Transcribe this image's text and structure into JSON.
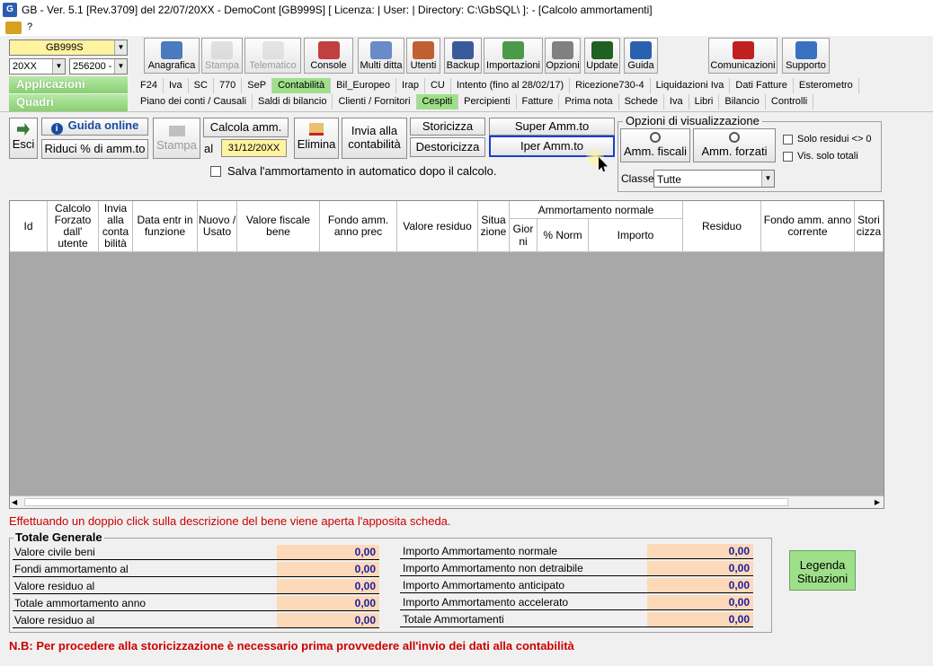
{
  "window": {
    "title": "GB - Ver. 5.1 [Rev.3709] del 22/07/20XX -  DemoCont [GB999S]   [ Licenza:                              | User:           | Directory: C:\\GbSQL\\ ]: - [Calcolo ammortamenti]",
    "menu_icon": "app-menu-icon",
    "menu_help": "?"
  },
  "selectors": {
    "company": "GB999S",
    "year": "20XX",
    "code": "256200 -",
    "applicazioni": "Applicazioni",
    "quadri": "Quadri"
  },
  "toolbar": [
    {
      "label": "Anagrafica",
      "icon": "address-book-icon",
      "enabled": true
    },
    {
      "label": "Stampa",
      "icon": "printer-icon",
      "enabled": false
    },
    {
      "label": "Telematico",
      "icon": "telematic-icon",
      "enabled": false
    },
    {
      "label": "Console",
      "icon": "console-icon",
      "enabled": true
    },
    {
      "label": "Multi ditta",
      "icon": "multi-company-icon",
      "enabled": true
    },
    {
      "label": "Utenti",
      "icon": "users-icon",
      "enabled": true
    },
    {
      "label": "Backup",
      "icon": "backup-icon",
      "enabled": true
    },
    {
      "label": "Importazioni",
      "icon": "import-icon",
      "enabled": true
    },
    {
      "label": "Opzioni",
      "icon": "tools-icon",
      "enabled": true
    },
    {
      "label": "Update",
      "icon": "update-icon",
      "enabled": true
    },
    {
      "label": "Guida",
      "icon": "help-icon",
      "enabled": true
    },
    {
      "label": "Comunicazioni",
      "icon": "communications-icon",
      "enabled": true
    },
    {
      "label": "Supporto",
      "icon": "support-icon",
      "enabled": true
    }
  ],
  "tabs_row1": [
    "F24",
    "Iva",
    "SC",
    "770",
    "SeP",
    "Contabilità",
    "Bil_Europeo",
    "Irap",
    "CU",
    "Intento (fino al 28/02/17)",
    "Ricezione730-4",
    "Liquidazioni Iva",
    "Dati Fatture",
    "Esterometro"
  ],
  "tabs_row2": [
    "Piano dei conti / Causali",
    "Saldi di bilancio",
    "Clienti / Fornitori",
    "Cespiti",
    "Percipienti",
    "Fatture",
    "Prima nota",
    "Schede",
    "Iva",
    "Libri",
    "Bilancio",
    "Controlli"
  ],
  "active_tab_row1": "Contabilità",
  "active_tab_row2": "Cespiti",
  "actions": {
    "esci": "Esci",
    "guida_online": "Guida online",
    "riduci": "Riduci % di amm.to",
    "stampa": "Stampa",
    "calcola": "Calcola amm.",
    "al": "al",
    "date": "31/12/20XX",
    "elimina": "Elimina",
    "invia_1": "Invia alla",
    "invia_2": "contabilità",
    "storicizza": "Storicizza",
    "destoricizza": "Destoricizza",
    "super": "Super Amm.to",
    "iper": "Iper Amm.to",
    "salva_auto": "Salva l'ammortamento in automatico dopo il calcolo."
  },
  "options": {
    "title": "Opzioni di visualizzazione",
    "amm_fiscali": "Amm. fiscali",
    "amm_forzati": "Amm. forzati",
    "solo_residui": "Solo residui <> 0",
    "vis_totali": "Vis. solo totali",
    "classe_label": "Classe",
    "classe_value": "Tutte"
  },
  "grid": {
    "columns": [
      {
        "key": "id",
        "label": "Id"
      },
      {
        "key": "calcolo",
        "label": "Calcolo Forzato dall' utente"
      },
      {
        "key": "invia",
        "label": "Invia alla conta bilità"
      },
      {
        "key": "data",
        "label": "Data entr in funzione"
      },
      {
        "key": "nuovo",
        "label": "Nuovo / Usato"
      },
      {
        "key": "valore_fiscale",
        "label": "Valore fiscale bene"
      },
      {
        "key": "fondo_prec",
        "label": "Fondo amm. anno prec"
      },
      {
        "key": "valore_residuo",
        "label": "Valore residuo"
      },
      {
        "key": "situazione",
        "label": "Situa zione"
      },
      {
        "key": "giorni",
        "label": "Gior ni"
      },
      {
        "key": "norm",
        "label": "% Norm"
      },
      {
        "key": "importo",
        "label": "Importo"
      },
      {
        "key": "residuo",
        "label": "Residuo"
      },
      {
        "key": "fondo_corrente",
        "label": "Fondo amm. anno corrente"
      },
      {
        "key": "storicizza",
        "label": "Stori cizza"
      }
    ],
    "group_header": "Ammortamento normale"
  },
  "hint": "Effettuando un doppio click sulla descrizione del bene viene aperta l'apposita scheda.",
  "totals": {
    "title": "Totale Generale",
    "left": [
      {
        "label": "Valore civile beni",
        "value": "0,00"
      },
      {
        "label": "Fondi ammortamento al",
        "value": "0,00"
      },
      {
        "label": "Valore residuo al",
        "value": "0,00"
      },
      {
        "label": "Totale ammortamento anno",
        "value": "0,00"
      },
      {
        "label": "Valore residuo al",
        "value": "0,00"
      }
    ],
    "right": [
      {
        "label": "Importo Ammortamento normale",
        "value": "0,00"
      },
      {
        "label": "Importo Ammortamento non detraibile",
        "value": "0,00"
      },
      {
        "label": "Importo Ammortamento anticipato",
        "value": "0,00"
      },
      {
        "label": "Importo Ammortamento accelerato",
        "value": "0,00"
      },
      {
        "label": "Totale Ammortamenti",
        "value": "0,00"
      }
    ]
  },
  "legenda": {
    "line1": "Legenda",
    "line2": "Situazioni"
  },
  "note": "N.B: Per procedere alla storicizzazione è necessario prima provvedere all'invio dei dati alla contabilità",
  "colors": {
    "accent_green": "#9ee08a",
    "highlight_blue": "#1a3fcf",
    "value_bg": "#fcd9b8",
    "warning_red": "#cc0000"
  }
}
